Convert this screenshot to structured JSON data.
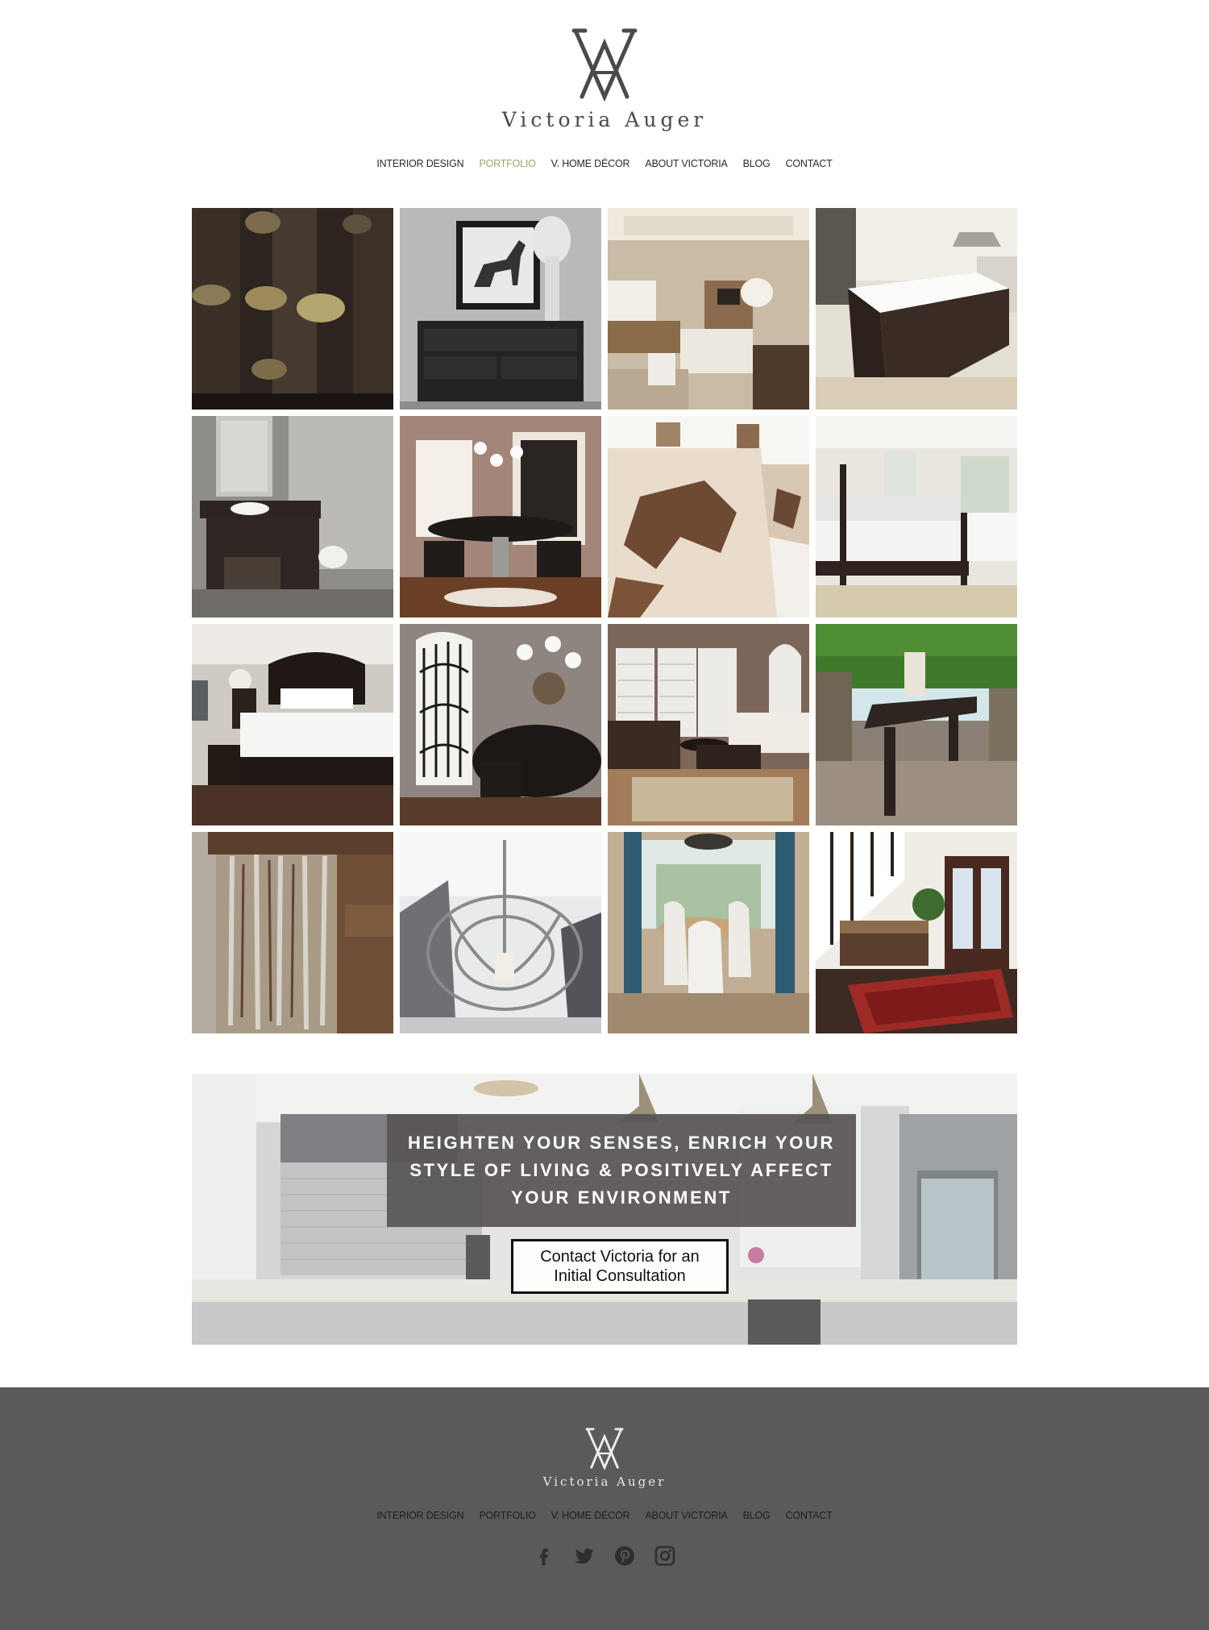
{
  "brand": {
    "name": "Victoria Auger",
    "logo_icon": "va-monogram-icon"
  },
  "nav": {
    "items": [
      {
        "label": "INTERIOR DESIGN",
        "active": false
      },
      {
        "label": "PORTFOLIO",
        "active": true
      },
      {
        "label": "V. HOME DÉCOR",
        "active": false
      },
      {
        "label": "ABOUT VICTORIA",
        "active": false
      },
      {
        "label": "BLOG",
        "active": false
      },
      {
        "label": "CONTACT",
        "active": false
      }
    ],
    "active_color": "#9aa86a"
  },
  "gallery": {
    "tiles": [
      "wine-rack-photo",
      "horse-art-console-photo",
      "living-room-photo",
      "kitchen-island-photo",
      "bathroom-vanity-photo",
      "dining-room-chandelier-photo",
      "cowhide-chairs-photo",
      "four-poster-bedroom-photo",
      "master-bedroom-photo",
      "dining-iron-doors-photo",
      "family-room-shutters-photo",
      "outdoor-table-photo",
      "distressed-cabinet-photo",
      "chandelier-detail-photo",
      "white-dining-chairs-photo",
      "entry-bench-rug-photo"
    ]
  },
  "banner": {
    "headline": "HEIGHTEN YOUR SENSES, ENRICH YOUR STYLE OF LIVING & POSITIVELY AFFECT YOUR ENVIRONMENT",
    "cta_label": "Contact Victoria for an Initial Consultation"
  },
  "footer": {
    "brand_name": "Victoria Auger",
    "nav_items": [
      "INTERIOR DESIGN",
      "PORTFOLIO",
      "V. HOME DÉCOR",
      "ABOUT VICTORIA",
      "BLOG",
      "CONTACT"
    ],
    "social": [
      "facebook-icon",
      "twitter-icon",
      "pinterest-icon",
      "instagram-icon"
    ],
    "background": "#5a5a5a"
  }
}
